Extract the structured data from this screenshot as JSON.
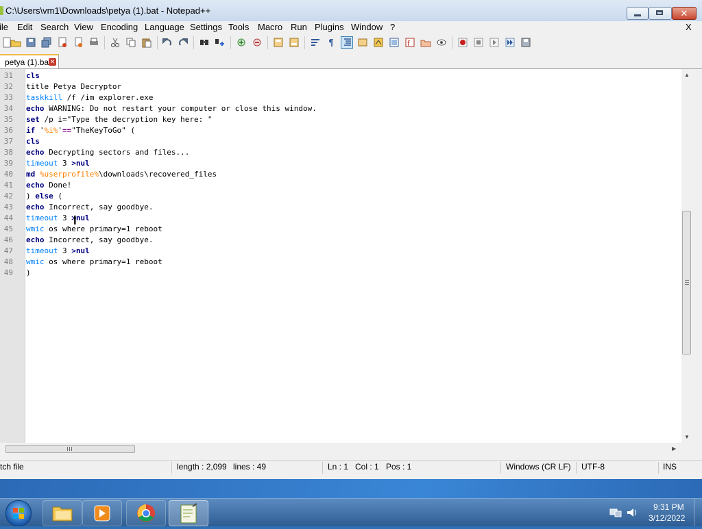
{
  "window": {
    "title": "C:\\Users\\vm1\\Downloads\\petya (1).bat - Notepad++"
  },
  "menu": [
    "ile",
    "Edit",
    "Search",
    "View",
    "Encoding",
    "Language",
    "Settings",
    "Tools",
    "Macro",
    "Run",
    "Plugins",
    "Window",
    "?"
  ],
  "menu_close": "X",
  "tab": {
    "label": "petya (1).bat"
  },
  "editor": {
    "line_numbers": [
      "31",
      "32",
      "33",
      "34",
      "35",
      "36",
      "37",
      "38",
      "39",
      "40",
      "41",
      "42",
      "43",
      "44",
      "45",
      "46",
      "47",
      "48",
      "49"
    ]
  },
  "status": {
    "file_type": "tch file",
    "length": "length : 2,099",
    "lines": "lines : 49",
    "ln": "Ln : 1",
    "col": "Col : 1",
    "pos": "Pos : 1",
    "eol": "Windows (CR LF)",
    "encoding": "UTF-8",
    "mode": "INS"
  },
  "taskbar": {
    "time": "9:31 PM",
    "date": "3/12/2022",
    "apps": [
      "windows-explorer-icon",
      "media-player-icon",
      "chrome-icon",
      "notepad-plus-plus-icon"
    ]
  },
  "colors": {
    "keyword": "#00007f",
    "command": "#0080ff",
    "variable": "#ff8000",
    "operator": "#7f007f"
  }
}
